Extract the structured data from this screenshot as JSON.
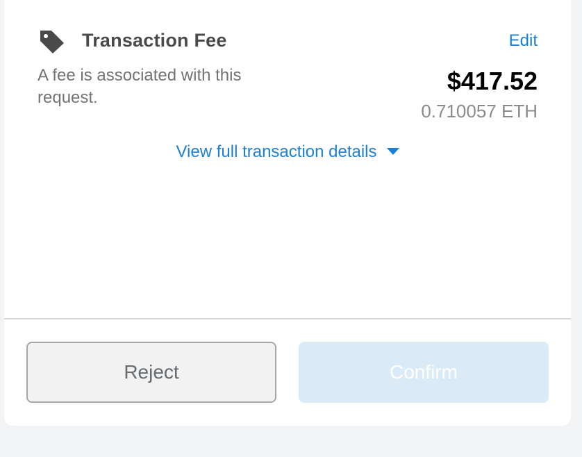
{
  "fee": {
    "title": "Transaction Fee",
    "icon": "tag-icon",
    "edit_label": "Edit",
    "description": "A fee is associated with this request.",
    "amount_usd": "$417.52",
    "amount_eth": "0.710057 ETH"
  },
  "details": {
    "link_label": "View full transaction details"
  },
  "actions": {
    "reject_label": "Reject",
    "confirm_label": "Confirm",
    "confirm_enabled": false
  },
  "colors": {
    "link": "#1c7fd1",
    "confirm_disabled_bg": "#dbeaf7",
    "reject_border": "#a6a6a6"
  }
}
